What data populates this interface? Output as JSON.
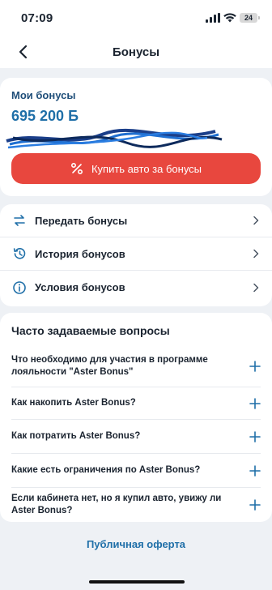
{
  "status_bar": {
    "time": "07:09",
    "battery": "24"
  },
  "nav": {
    "title": "Бонусы"
  },
  "bonus": {
    "label": "Мои бонусы",
    "amount": "695 200 Б",
    "buy_button": "Купить авто за бонусы"
  },
  "menu": [
    {
      "label": "Передать бонусы",
      "icon": "transfer-icon"
    },
    {
      "label": "История бонусов",
      "icon": "history-icon"
    },
    {
      "label": "Условия бонусов",
      "icon": "info-icon"
    }
  ],
  "faq": {
    "title": "Часто задаваемые вопросы",
    "items": [
      "Что необходимо для участия в программе лояльности \"Aster Bonus\"",
      "Как накопить Aster Bonus?",
      "Как потратить Aster Bonus?",
      "Какие есть ограничения по Aster Bonus?",
      "Если кабинета нет, но я купил авто, увижу ли Aster Bonus?"
    ]
  },
  "footer": {
    "offer_link": "Публичная оферта"
  },
  "colors": {
    "accent_red": "#e8473e",
    "accent_blue": "#1f6fa8",
    "background": "#eef1f5"
  }
}
